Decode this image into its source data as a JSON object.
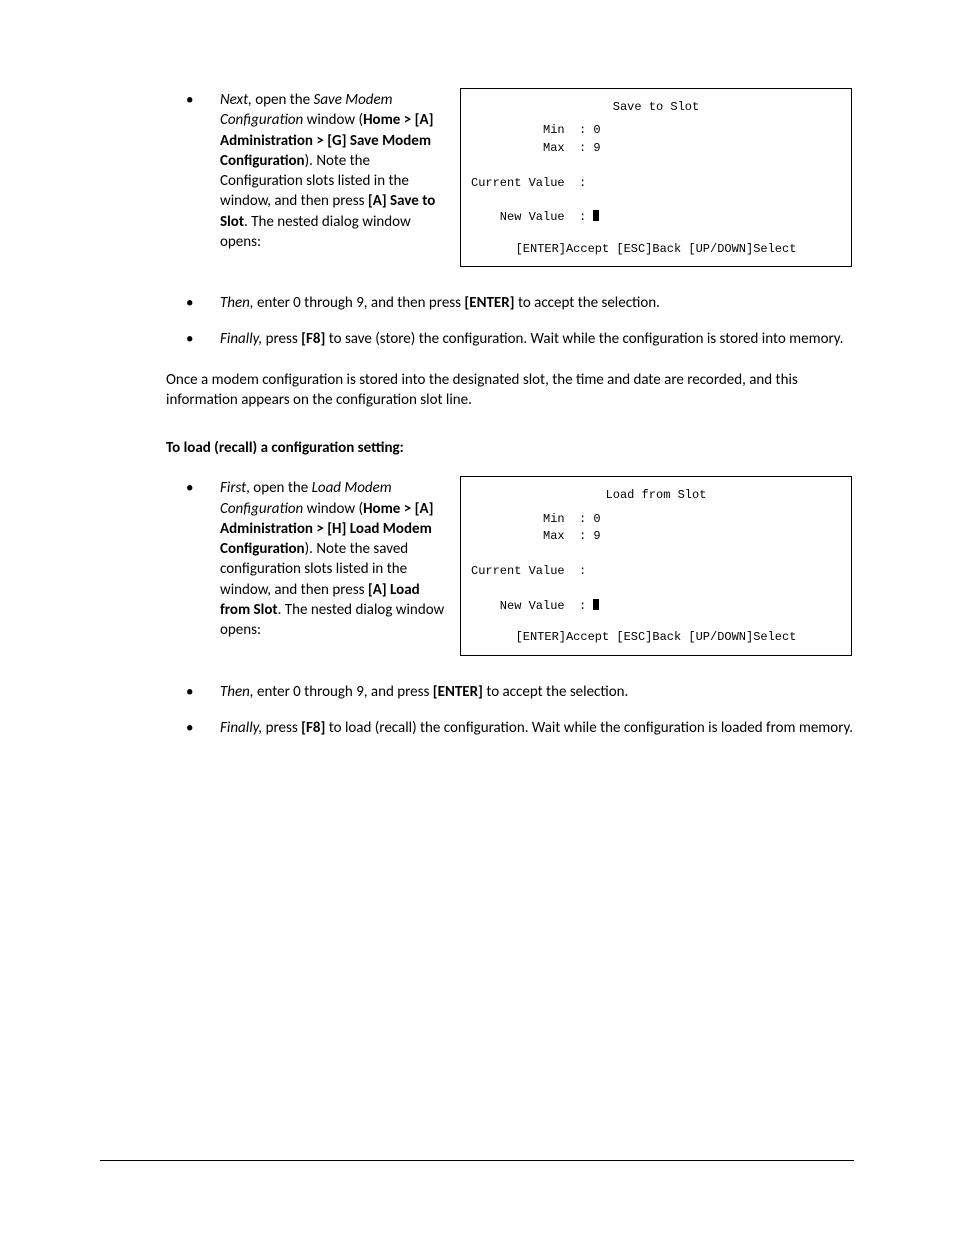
{
  "steps_save": {
    "next": {
      "lead_italic": "Next,",
      "t1": " open the ",
      "win_italic": "Save Modem Configuration",
      "t2": " window (",
      "nav_bold": "Home > [A] Administration > [G] Save Modem Configuration",
      "t3": "). Note the Configuration slots listed in the window, and then press ",
      "action_bold": "[A] Save to Slot",
      "t4": ". The nested dialog window opens:"
    },
    "then": {
      "lead_italic": "Then,",
      "t1": " enter 0 through 9, and then press ",
      "key_bold": "[ENTER]",
      "t2": " to accept the selection."
    },
    "finally": {
      "lead_italic": "Finally,",
      "t1": " press ",
      "key_bold": "[F8]",
      "t2": " to save (store) the configuration. Wait while the configuration is stored into memory."
    }
  },
  "mid_para": "Once a modem configuration is stored into the designated slot, the time and date are recorded, and this information appears on the configuration slot line.",
  "section_head": "To load (recall) a configuration setting:",
  "steps_load": {
    "first": {
      "lead_italic": "First",
      "t1": ", open the ",
      "win_italic": "Load Modem Configuration",
      "t2": " window (",
      "nav_bold": "Home > [A] Administration > [H] Load Modem Configuration",
      "t3": "). Note the saved configuration slots listed in the window, and then press ",
      "action_bold": "[A] Load from Slot",
      "t4": ". The nested dialog window opens:"
    },
    "then": {
      "lead_italic": "Then,",
      "t1": " enter 0 through 9, and press ",
      "key_bold": "[ENTER]",
      "t2": " to accept the selection."
    },
    "finally": {
      "lead_italic": "Finally,",
      "t1": " press ",
      "key_bold": "[F8]",
      "t2": " to load (recall) the configuration. Wait while the configuration is loaded from memory."
    }
  },
  "terminals": {
    "save": {
      "title": "Save to Slot",
      "min_line": "          Min  : 0",
      "max_line": "          Max  : 9",
      "current_line": "Current Value  :",
      "new_line": "    New Value  : ",
      "footer": "[ENTER]Accept [ESC]Back [UP/DOWN]Select"
    },
    "load": {
      "title": "Load from Slot",
      "min_line": "          Min  : 0",
      "max_line": "          Max  : 9",
      "current_line": "Current Value  :",
      "new_line": "    New Value  : ",
      "footer": "[ENTER]Accept [ESC]Back [UP/DOWN]Select"
    }
  },
  "bullet_char": "•"
}
